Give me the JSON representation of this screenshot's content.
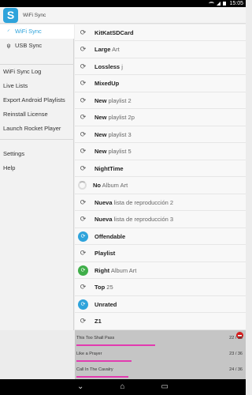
{
  "status": {
    "time": "15:05"
  },
  "app": {
    "title": "WiFi Sync",
    "logo": "S"
  },
  "sidebar": {
    "sync_items": [
      {
        "label": "WiFi Sync",
        "icon": "wifi-icon",
        "selected": true
      },
      {
        "label": "USB Sync",
        "icon": "usb-icon",
        "selected": false
      }
    ],
    "tools": [
      "WiFi Sync Log",
      "Live Lists",
      "Export Android Playlists",
      "Reinstall License",
      "Launch Rocket Player"
    ],
    "bottom": [
      "Settings",
      "Help"
    ]
  },
  "playlists": [
    {
      "bold": "KitKatSDCard",
      "rest": "",
      "icon": "sync-icon"
    },
    {
      "bold": "Large",
      "rest": "Art",
      "icon": "sync-icon"
    },
    {
      "bold": "Lossless",
      "rest": "j",
      "icon": "sync-icon"
    },
    {
      "bold": "MixedUp",
      "rest": "",
      "icon": "sync-icon"
    },
    {
      "bold": "New",
      "rest": "playlist 2",
      "icon": "sync-icon"
    },
    {
      "bold": "New",
      "rest": "playlist 2p",
      "icon": "sync-icon"
    },
    {
      "bold": "New",
      "rest": "playlist 3",
      "icon": "sync-icon"
    },
    {
      "bold": "New",
      "rest": "playlist 5",
      "icon": "sync-icon"
    },
    {
      "bold": "NightTime",
      "rest": "",
      "icon": "sync-icon"
    },
    {
      "bold": "No",
      "rest": "Album Art",
      "icon": "loading-icon"
    },
    {
      "bold": "Nueva",
      "rest": "lista de reproducción 2",
      "icon": "sync-icon"
    },
    {
      "bold": "Nueva",
      "rest": "lista de reproducción 3",
      "icon": "sync-icon"
    },
    {
      "bold": "Offendable",
      "rest": "",
      "icon": "sync-active-blue-icon"
    },
    {
      "bold": "Playlist",
      "rest": "",
      "icon": "sync-icon"
    },
    {
      "bold": "Right",
      "rest": "Album Art",
      "icon": "sync-done-green-icon"
    },
    {
      "bold": "Top",
      "rest": "25",
      "icon": "sync-icon"
    },
    {
      "bold": "Unrated",
      "rest": "",
      "icon": "sync-active-blue-icon"
    },
    {
      "bold": "Z1",
      "rest": "",
      "icon": "sync-icon"
    }
  ],
  "sync_progress": [
    {
      "name": "This Too Shall Pass",
      "count": "22 / 36",
      "progress": 0.5
    },
    {
      "name": "Like a Prayer",
      "count": "23 / 36",
      "progress": 0.35
    },
    {
      "name": "Call In The Cavalry",
      "count": "24 / 36",
      "progress": 0.33
    }
  ],
  "colors": {
    "accent": "#2ea3db",
    "progress": "#e23bb0",
    "stop": "#d41c1c",
    "done": "#3fae49"
  }
}
